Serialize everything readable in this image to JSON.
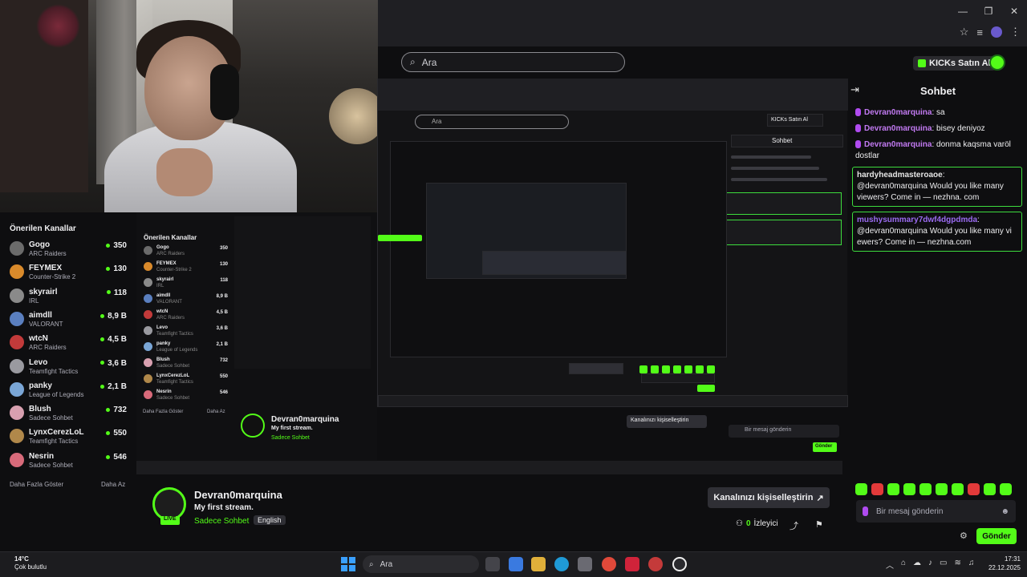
{
  "browser": {
    "controls": [
      "—",
      "❐",
      "✕"
    ],
    "toolbar_icons": [
      "star-icon",
      "playlist-icon",
      "profile-icon",
      "menu-icon"
    ]
  },
  "search": {
    "placeholder": "Ara"
  },
  "header": {
    "kicks_label": "KICKs Satın Al"
  },
  "sidebar": {
    "title": "Önerilen Kanallar",
    "channels": [
      {
        "name": "Gogo",
        "game": "ARC Raiders",
        "viewers": "350",
        "color": "#6b6b6b"
      },
      {
        "name": "FEYMEX",
        "game": "Counter-Strike 2",
        "viewers": "130",
        "color": "#d98a2b"
      },
      {
        "name": "skyrairl",
        "game": "IRL",
        "viewers": "118",
        "color": "#8a8a8a"
      },
      {
        "name": "aimdll",
        "game": "VALORANT",
        "viewers": "8,9 B",
        "color": "#5a7fbf"
      },
      {
        "name": "wtcN",
        "game": "ARC Raiders",
        "viewers": "4,5 B",
        "color": "#c23a3a"
      },
      {
        "name": "Levo",
        "game": "Teamfight Tactics",
        "viewers": "3,6 B",
        "color": "#9a9aa0"
      },
      {
        "name": "panky",
        "game": "League of Legends",
        "viewers": "2,1 B",
        "color": "#7aa6d6"
      },
      {
        "name": "Blush",
        "game": "Sadece Sohbet",
        "viewers": "732",
        "color": "#d8a0b0"
      },
      {
        "name": "LynxCerezLoL",
        "game": "Teamfight Tactics",
        "viewers": "550",
        "color": "#b0884a"
      },
      {
        "name": "Nesrin",
        "game": "Sadece Sohbet",
        "viewers": "546",
        "color": "#d86a7a"
      }
    ],
    "more": "Daha Fazla Göster",
    "less": "Daha Az"
  },
  "chat": {
    "title": "Sohbet",
    "messages": [
      {
        "user": "Devran0marquina",
        "text": ": sa",
        "style": "plain"
      },
      {
        "user": "Devran0marquina",
        "text": ": bisey deniyoz",
        "style": "plain"
      },
      {
        "user": "Devran0marquina",
        "text": ": donma kaqsma varöl dostlar",
        "style": "plain"
      },
      {
        "user": "hardyheadmasteroaoe",
        "text": ": @devran0marquina Would you like many viewers? Come in — nezhna. com",
        "style": "boxed"
      },
      {
        "user": "mushysummary7dwf4dgpdmda",
        "text": ": @devran0marquina Would you like many vi ewers? Come in — nezhna.com",
        "style": "boxed2"
      }
    ],
    "input_placeholder": "Bir mesaj gönderin",
    "send_label": "Gönder"
  },
  "stream": {
    "streamer": "Devran0marquina",
    "title": "My first stream.",
    "category": "Sadece Sohbet",
    "language": "English",
    "live": "LIVE",
    "customize_label": "Kanalınızı kişiselleştirin",
    "viewers_count": "0",
    "viewers_label": "İzleyici"
  },
  "taskbar": {
    "temp": "14°C",
    "weather": "Çok bulutlu",
    "search": "Ara",
    "time": "17:31",
    "date": "22.12.2025"
  },
  "nested": {
    "search": "Ara",
    "kicks_label": "KICKs Satın Al",
    "chat_title": "Sohbet"
  }
}
